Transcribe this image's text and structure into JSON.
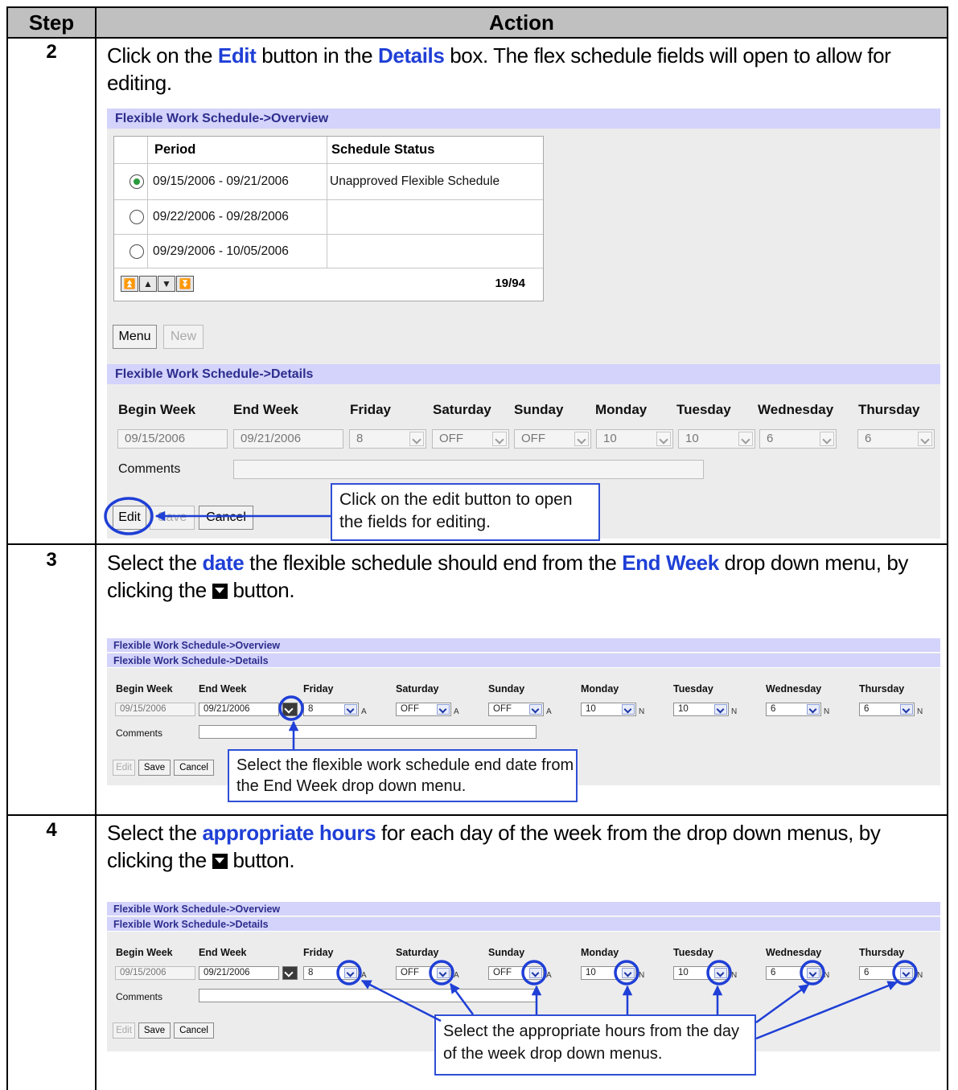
{
  "header": {
    "step": "Step",
    "action": "Action"
  },
  "steps": [
    {
      "number": "2",
      "instruction_parts": [
        "Click on the ",
        "Edit",
        " button in the ",
        "Details",
        " box.  The flex schedule fields will open to allow for editing."
      ],
      "screenshot": {
        "overview_title": "Flexible Work Schedule->Overview",
        "overview_columns": [
          "Period",
          "Schedule Status"
        ],
        "overview_rows": [
          {
            "period": "09/15/2006 - 09/21/2006",
            "status": "Unapproved Flexible Schedule",
            "selected": true
          },
          {
            "period": "09/22/2006 - 09/28/2006",
            "status": "",
            "selected": false
          },
          {
            "period": "09/29/2006 - 10/05/2006",
            "status": "",
            "selected": false
          }
        ],
        "overview_nav": [
          "⏫",
          "▲",
          "▼",
          "⏬"
        ],
        "overview_count": "19/94",
        "menu_button": "Menu",
        "new_button": "New",
        "details_title": "Flexible Work Schedule->Details",
        "columns": [
          "Begin Week",
          "End Week",
          "Friday",
          "Saturday",
          "Sunday",
          "Monday",
          "Tuesday",
          "Wednesday",
          "Thursday"
        ],
        "values": [
          "09/15/2006",
          "09/21/2006",
          "8",
          "OFF",
          "OFF",
          "10",
          "10",
          "6",
          "6"
        ],
        "comments_label": "Comments",
        "buttons": {
          "edit": "Edit",
          "save": "Save",
          "cancel": "Cancel"
        }
      },
      "callout": "Click on the edit button to open the fields for editing."
    },
    {
      "number": "3",
      "instruction_parts": [
        "Select the ",
        "date",
        " the flexible schedule should end from the ",
        "End Week",
        " drop down menu, by clicking the ",
        "",
        " button."
      ],
      "screenshot": {
        "overview_title": "Flexible Work Schedule->Overview",
        "details_title": "Flexible Work Schedule->Details",
        "columns": [
          "Begin Week",
          "End Week",
          "Friday",
          "Saturday",
          "Sunday",
          "Monday",
          "Tuesday",
          "Wednesday",
          "Thursday"
        ],
        "values": [
          "09/15/2006",
          "09/21/2006",
          "8",
          "OFF",
          "OFF",
          "10",
          "10",
          "6",
          "6"
        ],
        "suffixes": [
          "A",
          "A",
          "A",
          "N",
          "N",
          "N",
          "N"
        ],
        "comments_label": "Comments",
        "buttons": {
          "edit": "Edit",
          "save": "Save",
          "cancel": "Cancel"
        }
      },
      "callout": "Select the flexible work schedule end date from the End Week drop down menu."
    },
    {
      "number": "4",
      "instruction_parts": [
        "Select the ",
        "appropriate hours",
        " for each day of the week from the drop down menus, by clicking the ",
        "",
        " button."
      ],
      "screenshot": {
        "overview_title": "Flexible Work Schedule->Overview",
        "details_title": "Flexible Work Schedule->Details",
        "columns": [
          "Begin Week",
          "End Week",
          "Friday",
          "Saturday",
          "Sunday",
          "Monday",
          "Tuesday",
          "Wednesday",
          "Thursday"
        ],
        "values": [
          "09/15/2006",
          "09/21/2006",
          "8",
          "OFF",
          "OFF",
          "10",
          "10",
          "6",
          "6"
        ],
        "suffixes": [
          "A",
          "A",
          "A",
          "N",
          "N",
          "N",
          "N"
        ],
        "comments_label": "Comments",
        "buttons": {
          "edit": "Edit",
          "save": "Save",
          "cancel": "Cancel"
        }
      },
      "callout": "Select the appropriate hours from the day of the week drop down menus."
    }
  ],
  "colors": {
    "highlight": "#1f3fd6",
    "panel_bar": "#d3d3fb",
    "callout_border": "#2f4fd6"
  }
}
